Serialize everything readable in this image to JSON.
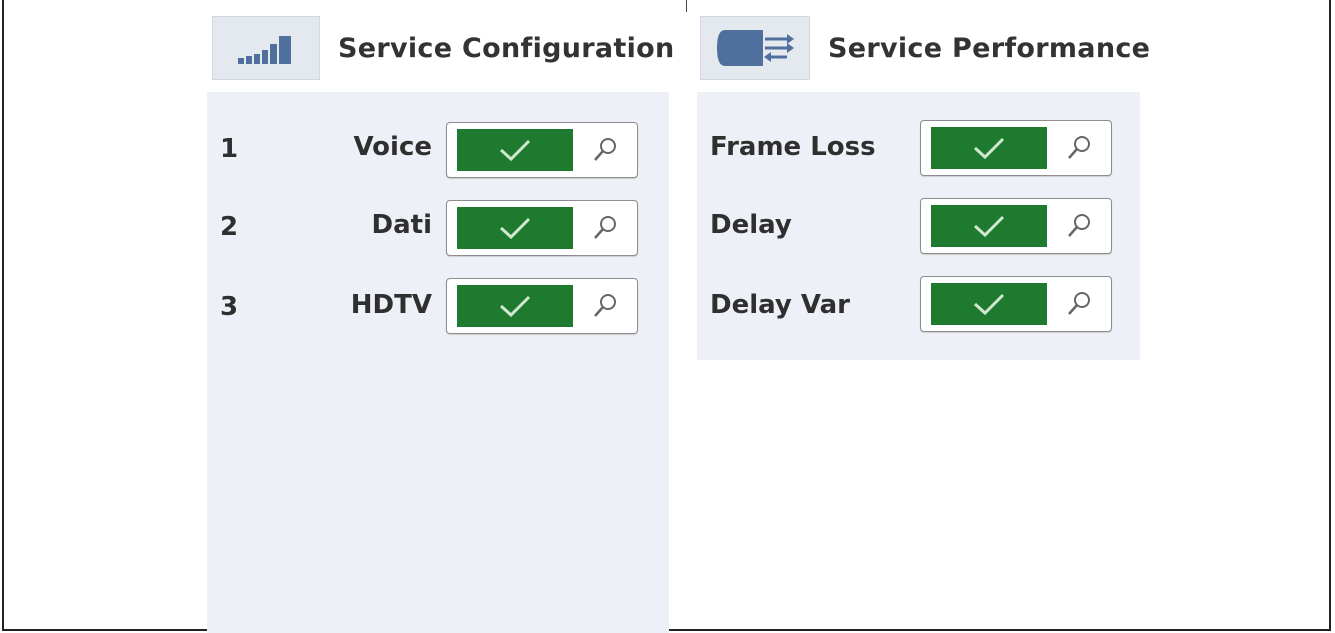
{
  "service_configuration": {
    "title": "Service Configuration",
    "icon": "bar-chart-icon",
    "items": [
      {
        "number": "1",
        "label": "Voice",
        "status": "pass"
      },
      {
        "number": "2",
        "label": "Dati",
        "status": "pass"
      },
      {
        "number": "3",
        "label": "HDTV",
        "status": "pass"
      }
    ]
  },
  "service_performance": {
    "title": "Service Performance",
    "icon": "flow-arrows-icon",
    "items": [
      {
        "label": "Frame Loss",
        "status": "pass"
      },
      {
        "label": "Delay",
        "status": "pass"
      },
      {
        "label": "Delay Var",
        "status": "pass"
      }
    ]
  },
  "colors": {
    "pass_green": "#1e7a2e",
    "panel_bg": "#eef0f8",
    "icon_blue": "#4f6f9c"
  }
}
